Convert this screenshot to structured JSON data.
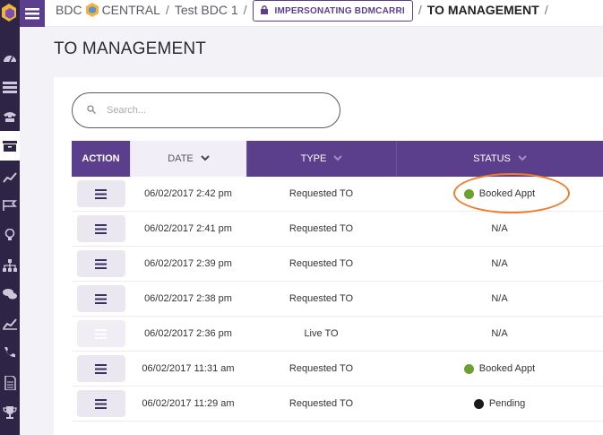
{
  "colors": {
    "sidebar": "#2e2446",
    "accent": "#5b3f8c",
    "booked": "#6aa132",
    "pending": "#1a1a1a",
    "annotation": "#f07d2a"
  },
  "sidebar": {
    "logo": "bdc-hex-logo",
    "items": [
      {
        "icon": "dashboard-icon"
      },
      {
        "icon": "server-icon"
      },
      {
        "icon": "phone-handset-icon"
      },
      {
        "icon": "archive-box-icon",
        "active": true
      },
      {
        "icon": "trend-chart-icon"
      },
      {
        "icon": "flags-icon"
      },
      {
        "icon": "lightbulb-icon"
      },
      {
        "icon": "org-chart-icon"
      },
      {
        "icon": "chat-bubbles-icon"
      },
      {
        "icon": "line-chart-icon"
      },
      {
        "icon": "phone-icon"
      },
      {
        "icon": "document-icon"
      },
      {
        "icon": "trophy-icon"
      }
    ]
  },
  "header": {
    "brand_left": "BDC",
    "brand_right": "CENTRAL",
    "sep": "/",
    "crumb_dealer": "Test BDC 1",
    "impersonating": "IMPERSONATING BDMCARRI",
    "crumb_current": "TO MANAGEMENT"
  },
  "page": {
    "title": "TO MANAGEMENT"
  },
  "search": {
    "placeholder": "Search...",
    "value": ""
  },
  "table": {
    "columns": {
      "action": "ACTION",
      "date": "DATE",
      "type": "TYPE",
      "status": "STATUS"
    },
    "rows": [
      {
        "date": "06/02/2017 2:42 pm",
        "type": "Requested TO",
        "status": "Booked Appt",
        "dot": "booked"
      },
      {
        "date": "06/02/2017 2:41 pm",
        "type": "Requested TO",
        "status": "N/A",
        "dot": ""
      },
      {
        "date": "06/02/2017 2:39 pm",
        "type": "Requested TO",
        "status": "N/A",
        "dot": ""
      },
      {
        "date": "06/02/2017 2:38 pm",
        "type": "Requested TO",
        "status": "N/A",
        "dot": ""
      },
      {
        "date": "06/02/2017 2:36 pm",
        "type": "Live TO",
        "status": "N/A",
        "dot": "",
        "disabled": true
      },
      {
        "date": "06/02/2017 11:31 am",
        "type": "Requested TO",
        "status": "Booked Appt",
        "dot": "booked"
      },
      {
        "date": "06/02/2017 11:29 am",
        "type": "Requested TO",
        "status": "Pending",
        "dot": "pending"
      }
    ]
  }
}
